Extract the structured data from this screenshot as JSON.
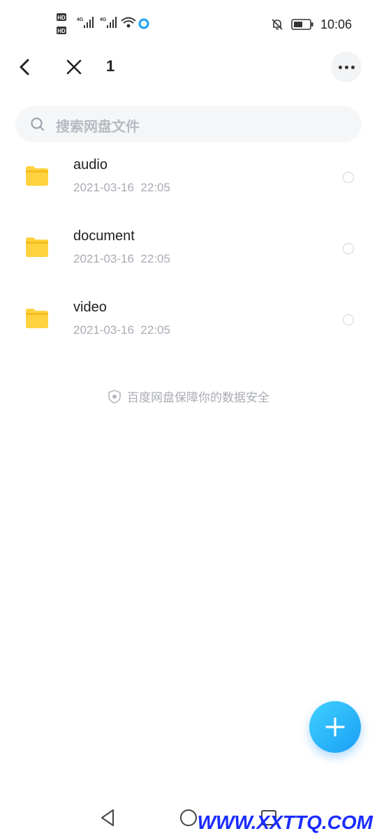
{
  "status_bar": {
    "time": "10:06",
    "icons": [
      "hd-icon",
      "signal-4g-icon",
      "signal-4g-icon",
      "wifi-icon",
      "browser-icon",
      "bell-off-icon",
      "battery-icon"
    ]
  },
  "top_bar": {
    "selected_count": "1"
  },
  "search": {
    "placeholder": "搜索网盘文件"
  },
  "files": [
    {
      "name": "audio",
      "date": "2021-03-16  22:05"
    },
    {
      "name": "document",
      "date": "2021-03-16  22:05"
    },
    {
      "name": "video",
      "date": "2021-03-16  22:05"
    }
  ],
  "security_note": "百度网盘保障你的数据安全",
  "watermark": "WWW.XXTTQ.COM",
  "colors": {
    "folder": "#ffd23f",
    "fab_start": "#3fd0ff",
    "fab_end": "#1aa0f5",
    "watermark": "#1a2cff"
  }
}
